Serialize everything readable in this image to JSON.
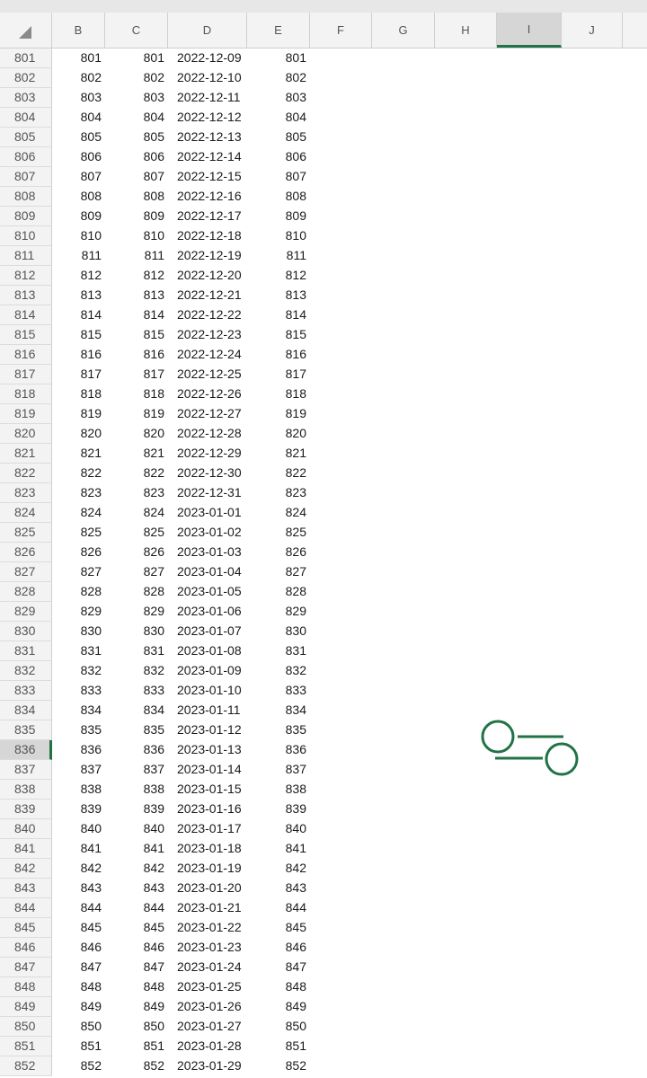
{
  "columns": [
    "B",
    "C",
    "D",
    "E",
    "F",
    "G",
    "H",
    "I",
    "J"
  ],
  "selected_column": "I",
  "selected_row": "836",
  "rows": [
    {
      "n": "801",
      "b": "801",
      "c": "801",
      "d": "2022-12-09",
      "e": "801"
    },
    {
      "n": "802",
      "b": "802",
      "c": "802",
      "d": "2022-12-10",
      "e": "802"
    },
    {
      "n": "803",
      "b": "803",
      "c": "803",
      "d": "2022-12-11",
      "e": "803"
    },
    {
      "n": "804",
      "b": "804",
      "c": "804",
      "d": "2022-12-12",
      "e": "804"
    },
    {
      "n": "805",
      "b": "805",
      "c": "805",
      "d": "2022-12-13",
      "e": "805"
    },
    {
      "n": "806",
      "b": "806",
      "c": "806",
      "d": "2022-12-14",
      "e": "806"
    },
    {
      "n": "807",
      "b": "807",
      "c": "807",
      "d": "2022-12-15",
      "e": "807"
    },
    {
      "n": "808",
      "b": "808",
      "c": "808",
      "d": "2022-12-16",
      "e": "808"
    },
    {
      "n": "809",
      "b": "809",
      "c": "809",
      "d": "2022-12-17",
      "e": "809"
    },
    {
      "n": "810",
      "b": "810",
      "c": "810",
      "d": "2022-12-18",
      "e": "810"
    },
    {
      "n": "811",
      "b": "811",
      "c": "811",
      "d": "2022-12-19",
      "e": "811"
    },
    {
      "n": "812",
      "b": "812",
      "c": "812",
      "d": "2022-12-20",
      "e": "812"
    },
    {
      "n": "813",
      "b": "813",
      "c": "813",
      "d": "2022-12-21",
      "e": "813"
    },
    {
      "n": "814",
      "b": "814",
      "c": "814",
      "d": "2022-12-22",
      "e": "814"
    },
    {
      "n": "815",
      "b": "815",
      "c": "815",
      "d": "2022-12-23",
      "e": "815"
    },
    {
      "n": "816",
      "b": "816",
      "c": "816",
      "d": "2022-12-24",
      "e": "816"
    },
    {
      "n": "817",
      "b": "817",
      "c": "817",
      "d": "2022-12-25",
      "e": "817"
    },
    {
      "n": "818",
      "b": "818",
      "c": "818",
      "d": "2022-12-26",
      "e": "818"
    },
    {
      "n": "819",
      "b": "819",
      "c": "819",
      "d": "2022-12-27",
      "e": "819"
    },
    {
      "n": "820",
      "b": "820",
      "c": "820",
      "d": "2022-12-28",
      "e": "820"
    },
    {
      "n": "821",
      "b": "821",
      "c": "821",
      "d": "2022-12-29",
      "e": "821"
    },
    {
      "n": "822",
      "b": "822",
      "c": "822",
      "d": "2022-12-30",
      "e": "822"
    },
    {
      "n": "823",
      "b": "823",
      "c": "823",
      "d": "2022-12-31",
      "e": "823"
    },
    {
      "n": "824",
      "b": "824",
      "c": "824",
      "d": "2023-01-01",
      "e": "824"
    },
    {
      "n": "825",
      "b": "825",
      "c": "825",
      "d": "2023-01-02",
      "e": "825"
    },
    {
      "n": "826",
      "b": "826",
      "c": "826",
      "d": "2023-01-03",
      "e": "826"
    },
    {
      "n": "827",
      "b": "827",
      "c": "827",
      "d": "2023-01-04",
      "e": "827"
    },
    {
      "n": "828",
      "b": "828",
      "c": "828",
      "d": "2023-01-05",
      "e": "828"
    },
    {
      "n": "829",
      "b": "829",
      "c": "829",
      "d": "2023-01-06",
      "e": "829"
    },
    {
      "n": "830",
      "b": "830",
      "c": "830",
      "d": "2023-01-07",
      "e": "830"
    },
    {
      "n": "831",
      "b": "831",
      "c": "831",
      "d": "2023-01-08",
      "e": "831"
    },
    {
      "n": "832",
      "b": "832",
      "c": "832",
      "d": "2023-01-09",
      "e": "832"
    },
    {
      "n": "833",
      "b": "833",
      "c": "833",
      "d": "2023-01-10",
      "e": "833"
    },
    {
      "n": "834",
      "b": "834",
      "c": "834",
      "d": "2023-01-11",
      "e": "834"
    },
    {
      "n": "835",
      "b": "835",
      "c": "835",
      "d": "2023-01-12",
      "e": "835"
    },
    {
      "n": "836",
      "b": "836",
      "c": "836",
      "d": "2023-01-13",
      "e": "836"
    },
    {
      "n": "837",
      "b": "837",
      "c": "837",
      "d": "2023-01-14",
      "e": "837"
    },
    {
      "n": "838",
      "b": "838",
      "c": "838",
      "d": "2023-01-15",
      "e": "838"
    },
    {
      "n": "839",
      "b": "839",
      "c": "839",
      "d": "2023-01-16",
      "e": "839"
    },
    {
      "n": "840",
      "b": "840",
      "c": "840",
      "d": "2023-01-17",
      "e": "840"
    },
    {
      "n": "841",
      "b": "841",
      "c": "841",
      "d": "2023-01-18",
      "e": "841"
    },
    {
      "n": "842",
      "b": "842",
      "c": "842",
      "d": "2023-01-19",
      "e": "842"
    },
    {
      "n": "843",
      "b": "843",
      "c": "843",
      "d": "2023-01-20",
      "e": "843"
    },
    {
      "n": "844",
      "b": "844",
      "c": "844",
      "d": "2023-01-21",
      "e": "844"
    },
    {
      "n": "845",
      "b": "845",
      "c": "845",
      "d": "2023-01-22",
      "e": "845"
    },
    {
      "n": "846",
      "b": "846",
      "c": "846",
      "d": "2023-01-23",
      "e": "846"
    },
    {
      "n": "847",
      "b": "847",
      "c": "847",
      "d": "2023-01-24",
      "e": "847"
    },
    {
      "n": "848",
      "b": "848",
      "c": "848",
      "d": "2023-01-25",
      "e": "848"
    },
    {
      "n": "849",
      "b": "849",
      "c": "849",
      "d": "2023-01-26",
      "e": "849"
    },
    {
      "n": "850",
      "b": "850",
      "c": "850",
      "d": "2023-01-27",
      "e": "850"
    },
    {
      "n": "851",
      "b": "851",
      "c": "851",
      "d": "2023-01-28",
      "e": "851"
    },
    {
      "n": "852",
      "b": "852",
      "c": "852",
      "d": "2023-01-29",
      "e": "852"
    }
  ],
  "icons": {
    "corner": "select-all-triangle-icon",
    "selection_handles": "selection-handles-icon"
  },
  "colors": {
    "accent": "#217346",
    "header_bg": "#f3f3f3",
    "selected_header_bg": "#d6d6d6"
  }
}
